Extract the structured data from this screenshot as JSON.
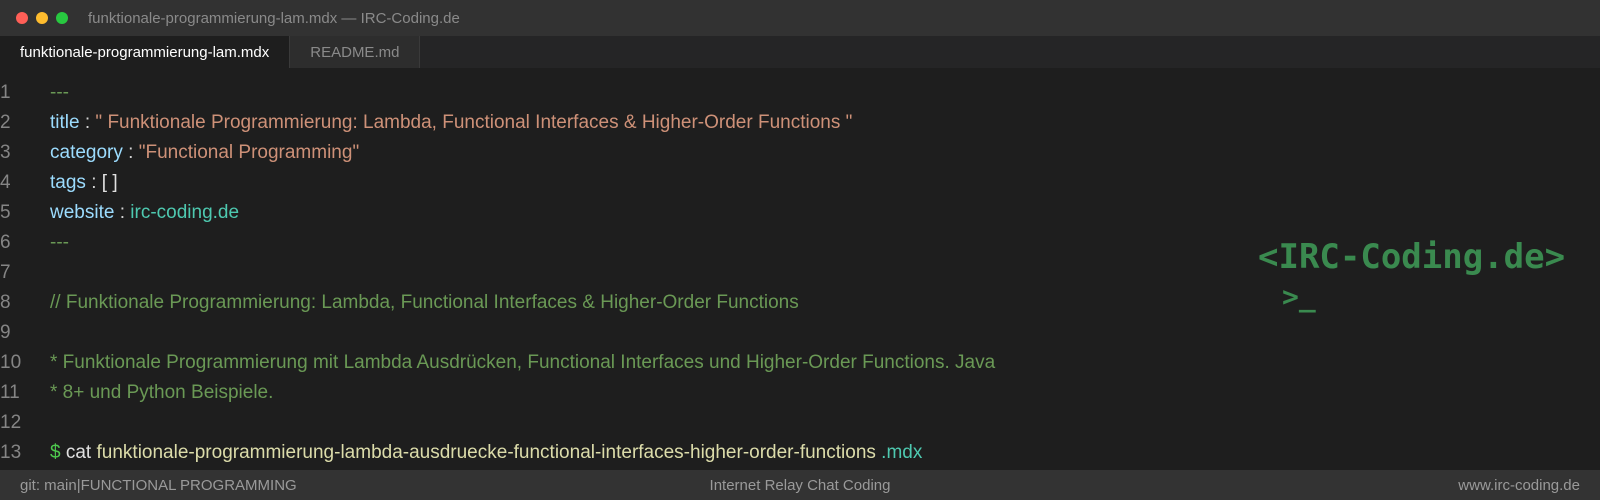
{
  "window": {
    "title": "funktionale-programmierung-lam.mdx — IRC-Coding.de"
  },
  "tabs": [
    {
      "label": "funktionale-programmierung-lam.mdx",
      "active": true
    },
    {
      "label": "README.md",
      "active": false
    }
  ],
  "editor": {
    "lines": [
      {
        "num": "1",
        "frontmatter_sep": "---"
      },
      {
        "num": "2",
        "key": "title",
        "colon": ":",
        "value": "\" Funktionale Programmierung: Lambda, Functional Interfaces & Higher-Order Functions \""
      },
      {
        "num": "3",
        "key": "category",
        "colon": ":",
        "value": "\"Functional Programming\""
      },
      {
        "num": "4",
        "key": "tags",
        "colon": ":",
        "value": "[ ]"
      },
      {
        "num": "5",
        "key": "website",
        "colon": ":",
        "value": "irc-coding.de"
      },
      {
        "num": "6",
        "frontmatter_sep": "---"
      },
      {
        "num": "7"
      },
      {
        "num": "8",
        "comment": "// Funktionale Programmierung: Lambda, Functional Interfaces & Higher-Order Functions"
      },
      {
        "num": "9"
      },
      {
        "num": "10",
        "comment": "* Funktionale Programmierung mit Lambda Ausdrücken, Functional Interfaces und Higher-Order Functions. Java"
      },
      {
        "num": "11",
        "comment": "* 8+ und Python Beispiele."
      },
      {
        "num": "12"
      },
      {
        "num": "13",
        "prompt": "$",
        "cmd": "cat",
        "file": "funktionale-programmierung-lambda-ausdruecke-functional-interfaces-higher-order-functions",
        "ext": ".mdx"
      }
    ]
  },
  "logo": {
    "text": "<IRC-Coding.de>",
    "prompt": ">_"
  },
  "statusbar": {
    "left": "git: main|FUNCTIONAL PROGRAMMING",
    "center": "Internet Relay Chat Coding",
    "right": "www.irc-coding.de"
  },
  "colors": {
    "titlebar_bg": "#323232",
    "editor_bg": "#1e1e1e",
    "statusbar_bg": "#333333",
    "logo_green": "#3a8a4f"
  }
}
